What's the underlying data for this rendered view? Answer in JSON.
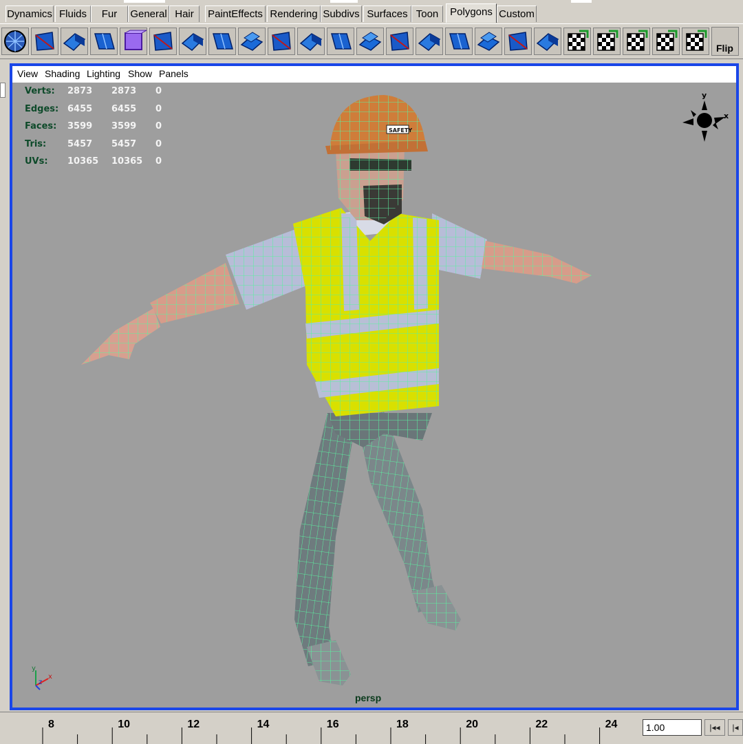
{
  "shelf_tabs": [
    {
      "label": "Dynamics"
    },
    {
      "label": "Fluids"
    },
    {
      "label": "Fur"
    },
    {
      "label": "General"
    },
    {
      "label": "Hair"
    },
    {
      "label": "PaintEffects"
    },
    {
      "label": "Rendering"
    },
    {
      "label": "Subdivs"
    },
    {
      "label": "Surfaces"
    },
    {
      "label": "Toon"
    },
    {
      "label": "Polygons"
    },
    {
      "label": "Custom"
    }
  ],
  "active_tab": "Polygons",
  "shelf_icons": [
    "polygon-sphere-icon",
    "polygon-plane-icon",
    "polygon-extrude-icon",
    "polygon-smooth-icon",
    "polygon-cube-icon",
    "polygon-split-icon",
    "polygon-cut-icon",
    "polygon-bevel-icon",
    "polygon-merge-icon",
    "polygon-extrude-face-icon",
    "polygon-duplicate-icon",
    "polygon-extract-icon",
    "polygon-append-icon",
    "polygon-wedge-icon",
    "polygon-poke-icon",
    "polygon-bridge-icon",
    "polygon-combine-icon",
    "polygon-separate-icon",
    "polygon-pivot-icon",
    "uv-planar-map-icon",
    "uv-automatic-map-icon",
    "uv-cylindrical-map-icon",
    "uv-spherical-map-icon",
    "uv-texture-editor-icon",
    "uv-checker-icon"
  ],
  "flip_label": "Flip",
  "panel_menu": [
    "View",
    "Shading",
    "Lighting",
    "Show",
    "Panels"
  ],
  "hud": [
    {
      "label": "Verts:",
      "a": "2873",
      "b": "2873",
      "c": "0"
    },
    {
      "label": "Edges:",
      "a": "6455",
      "b": "6455",
      "c": "0"
    },
    {
      "label": "Faces:",
      "a": "3599",
      "b": "3599",
      "c": "0"
    },
    {
      "label": "Tris:",
      "a": "5457",
      "b": "5457",
      "c": "0"
    },
    {
      "label": "UVs:",
      "a": "10365",
      "b": "10365",
      "c": "0"
    }
  ],
  "camera_label": "persp",
  "view_cube_axes": {
    "y": "y",
    "x": "x"
  },
  "axis_gizmo": {
    "y": "y",
    "x": "x",
    "z": "z"
  },
  "helmet_badge": "SAFETY",
  "timeline_ticks": [
    "8",
    "10",
    "12",
    "14",
    "16",
    "18",
    "20",
    "22",
    "24"
  ],
  "current_frame": "1.00",
  "timeline_buttons": {
    "rewind": "|◂◂",
    "step_back": "|◂"
  },
  "colors": {
    "viewport_bg": "#9e9e9e",
    "panel_border": "#1a46e8",
    "wireframe": "#5cf0a0",
    "vest": "#d9e000",
    "hud_label": "#0e4a2a"
  }
}
